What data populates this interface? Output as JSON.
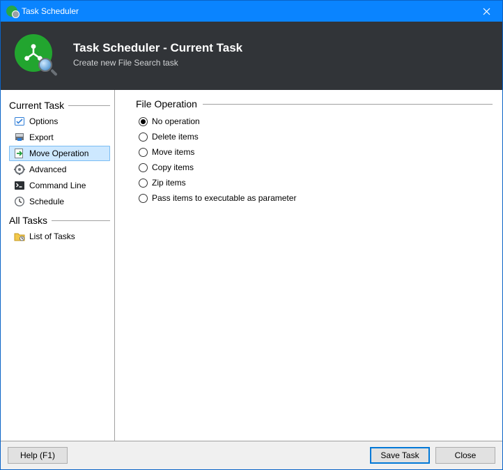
{
  "window": {
    "title": "Task Scheduler"
  },
  "header": {
    "title": "Task Scheduler - Current Task",
    "subtitle": "Create new File Search task"
  },
  "sidebar": {
    "sections": [
      {
        "title": "Current Task",
        "items": [
          {
            "label": "Options",
            "icon": "options-icon"
          },
          {
            "label": "Export",
            "icon": "export-icon"
          },
          {
            "label": "Move Operation",
            "icon": "move-operation-icon",
            "selected": true
          },
          {
            "label": "Advanced",
            "icon": "advanced-icon"
          },
          {
            "label": "Command Line",
            "icon": "command-line-icon"
          },
          {
            "label": "Schedule",
            "icon": "schedule-icon"
          }
        ]
      },
      {
        "title": "All Tasks",
        "items": [
          {
            "label": "List of Tasks",
            "icon": "list-of-tasks-icon"
          }
        ]
      }
    ]
  },
  "content": {
    "group_title": "File Operation",
    "options": [
      {
        "label": "No operation",
        "checked": true
      },
      {
        "label": "Delete items"
      },
      {
        "label": "Move items"
      },
      {
        "label": "Copy items"
      },
      {
        "label": "Zip items"
      },
      {
        "label": "Pass items to executable as parameter"
      }
    ]
  },
  "footer": {
    "help": "Help (F1)",
    "save": "Save Task",
    "close": "Close"
  }
}
